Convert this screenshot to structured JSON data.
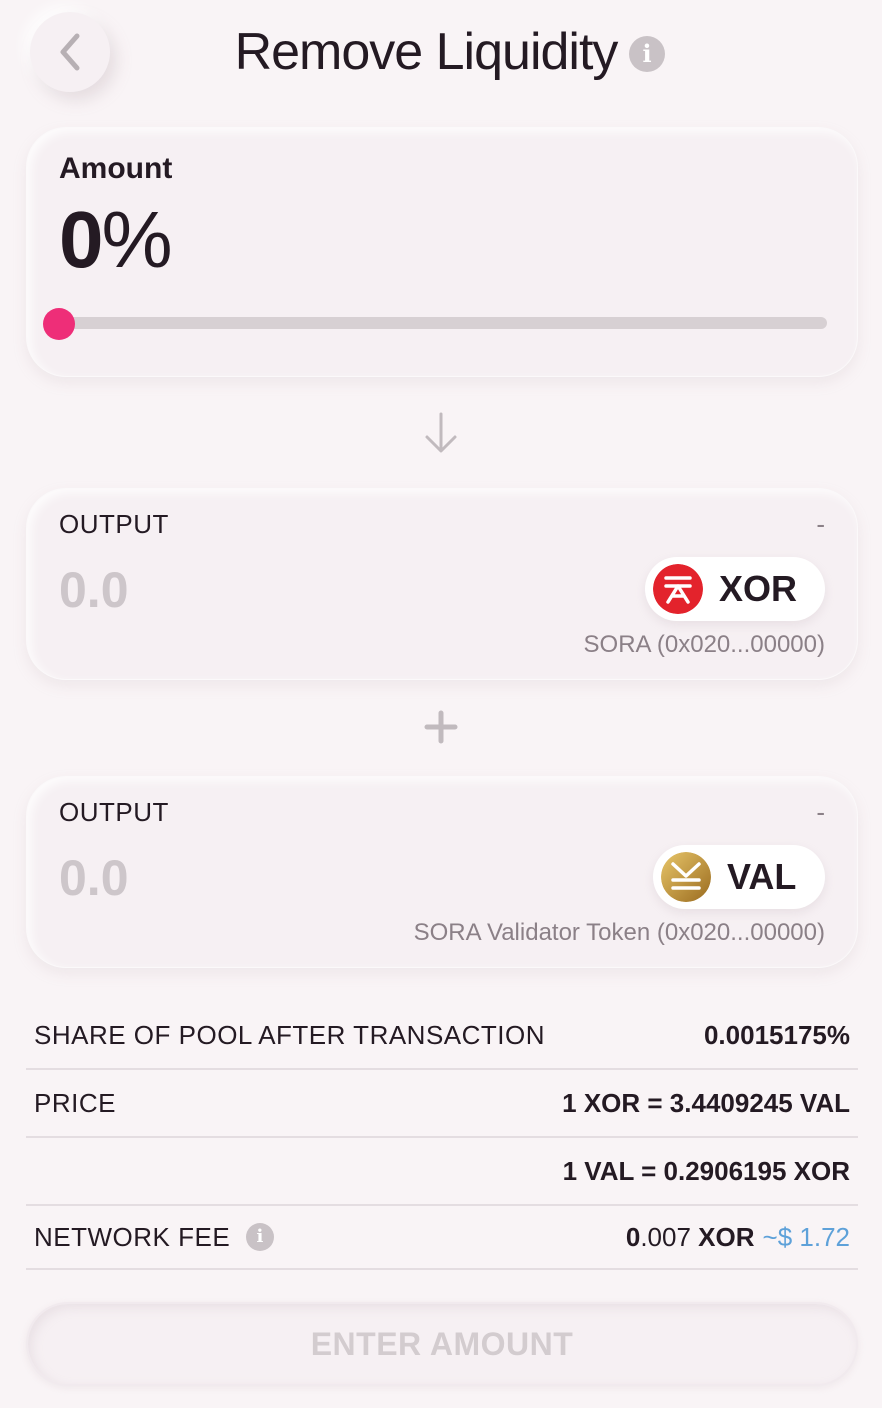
{
  "header": {
    "title": "Remove Liquidity",
    "info_glyph": "i"
  },
  "amount": {
    "label": "Amount",
    "value_number": "0",
    "value_unit": "%",
    "slider_value_percent": 0
  },
  "outputs": [
    {
      "label": "OUTPUT",
      "balance": "-",
      "value": "0.0",
      "token_symbol": "XOR",
      "token_name": "SORA (0x020...00000)",
      "icon": "xor-token-icon",
      "icon_color": "#e3232c"
    },
    {
      "label": "OUTPUT",
      "balance": "-",
      "value": "0.0",
      "token_symbol": "VAL",
      "token_name": "SORA Validator Token (0x020...00000)",
      "icon": "val-token-icon",
      "icon_color": "#c99a3b"
    }
  ],
  "info": {
    "share_label": "SHARE OF POOL AFTER TRANSACTION",
    "share_value": "0.0015175%",
    "price_label": "PRICE",
    "price_xor_val": "1 XOR = 3.4409245 VAL",
    "price_val_xor": "1 VAL = 0.2906195 XOR",
    "fee_label": "NETWORK FEE",
    "fee_int": "0",
    "fee_dec": ".007",
    "fee_symbol": "XOR",
    "fee_usd": "~$ 1.72"
  },
  "submit": {
    "label": "ENTER AMOUNT"
  },
  "colors": {
    "accent": "#ee2e78",
    "background": "#f9f4f6",
    "usd": "#5ea1d9"
  }
}
